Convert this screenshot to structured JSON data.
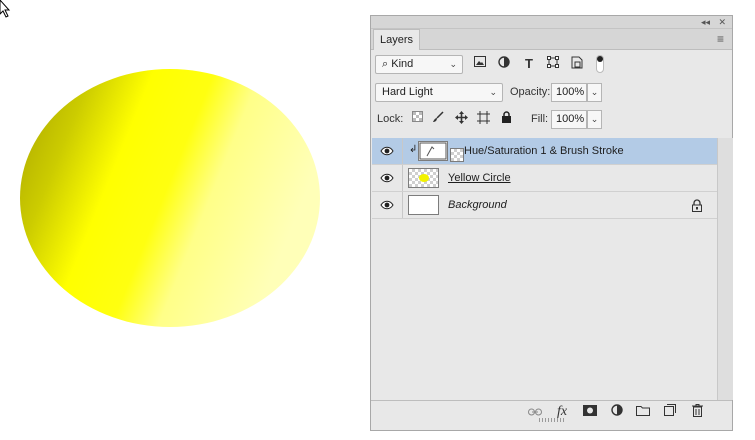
{
  "panel": {
    "tab_label": "Layers",
    "collapse_glyph": "◂◂",
    "close_glyph": "✕",
    "menu_glyph": "≡"
  },
  "filter": {
    "kind_label": "Kind",
    "icons": [
      "pixel-layer-filter-icon",
      "adjustment-layer-filter-icon",
      "type-layer-filter-icon",
      "shape-layer-filter-icon",
      "smart-object-filter-icon"
    ]
  },
  "blend": {
    "mode": "Hard Light",
    "opacity_label": "Opacity:",
    "opacity_value": "100%",
    "lock_label": "Lock:",
    "fill_label": "Fill:",
    "fill_value": "100%"
  },
  "layers": [
    {
      "name": "Hue/Saturation 1 & Brush Stroke",
      "selected": true,
      "clipped": true,
      "style": "normal"
    },
    {
      "name": "Yellow Circle",
      "selected": false,
      "style": "underline"
    },
    {
      "name": "Background",
      "selected": false,
      "style": "italic",
      "locked": true
    }
  ],
  "footer_icons": [
    "link-layers-icon",
    "fx-icon",
    "add-mask-icon",
    "new-adjustment-icon",
    "new-group-icon",
    "new-layer-icon",
    "delete-layer-icon"
  ],
  "footer_fx_label": "fx",
  "colors": {
    "selected_row": "#b3cbe6",
    "panel_bg": "#e8e8e8",
    "circle_yellow": "#ffff00",
    "circle_shadow": "#b7b300"
  }
}
